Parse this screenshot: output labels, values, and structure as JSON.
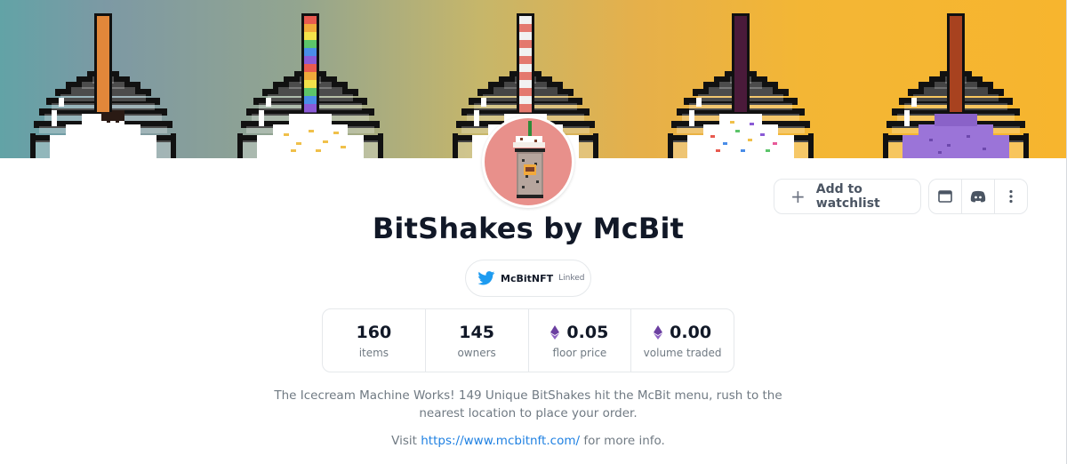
{
  "collection": {
    "name": "BitShakes by McBit",
    "twitter": {
      "handle": "McBitNFT",
      "status": "Linked"
    },
    "description": "The Icecream Machine Works! 149 Unique BitShakes hit the McBit menu, rush to the nearest location to place your order.",
    "visit_prefix": "Visit",
    "website": "https://www.mcbitnft.com/",
    "visit_suffix": "for more info."
  },
  "actions": {
    "watchlist_label": "Add to watchlist",
    "icons": [
      "website-icon",
      "discord-icon",
      "more-vertical-icon"
    ]
  },
  "stats": [
    {
      "value": "160",
      "label": "items",
      "eth": false
    },
    {
      "value": "145",
      "label": "owners",
      "eth": false
    },
    {
      "value": "0.05",
      "label": "floor price",
      "eth": true
    },
    {
      "value": "0.00",
      "label": "volume traded",
      "eth": true
    }
  ],
  "colors": {
    "accent_link": "#2081e2",
    "twitter_blue": "#1d9bf0",
    "eth_purple": "#6b3fa0",
    "avatar_bg": "#e8908b"
  }
}
